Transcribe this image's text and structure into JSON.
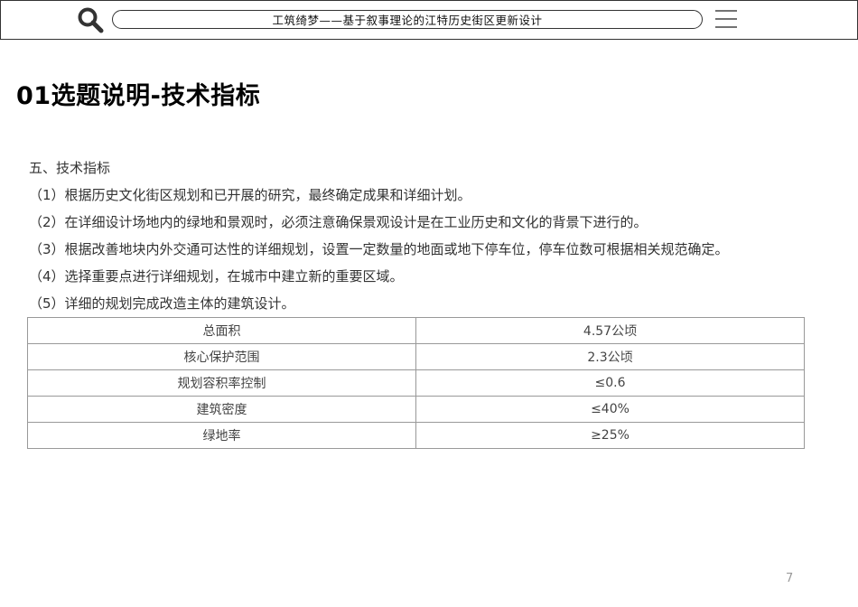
{
  "header": {
    "title": "工筑绮梦——基于叙事理论的江特历史街区更新设计",
    "search_icon": "search-icon",
    "menu_icon": "hamburger-menu-icon"
  },
  "page_title": "01选题说明-技术指标",
  "content": {
    "lines": [
      "五、技术指标",
      "（1）根据历史文化街区规划和已开展的研究，最终确定成果和详细计划。",
      "（2）在详细设计场地内的绿地和景观时，必须注意确保景观设计是在工业历史和文化的背景下进行的。",
      "（3）根据改善地块内外交通可达性的详细规划，设置一定数量的地面或地下停车位，停车位数可根据相关规范确定。",
      "（4）选择重要点进行详细规划，在城市中建立新的重要区域。",
      "（5）详细的规划完成改造主体的建筑设计。"
    ]
  },
  "table": {
    "rows": [
      {
        "label": "总面积",
        "value": "4.57公顷"
      },
      {
        "label": "核心保护范围",
        "value": "2.3公顷"
      },
      {
        "label": "规划容积率控制",
        "value": "≤0.6"
      },
      {
        "label": "建筑密度",
        "value": "≤40%"
      },
      {
        "label": "绿地率",
        "value": "≥25%"
      }
    ]
  },
  "page_number": "7"
}
